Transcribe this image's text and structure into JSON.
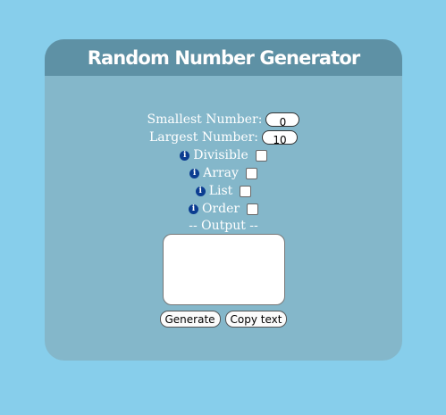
{
  "title": "Random Number Generator",
  "smallest": {
    "label": "Smallest Number:",
    "value": "0"
  },
  "largest": {
    "label": "Largest Number:",
    "value": "10"
  },
  "options": [
    {
      "label": "Divisible",
      "icon": "info-icon",
      "checked": false
    },
    {
      "label": "Array",
      "icon": "info-icon",
      "checked": false
    },
    {
      "label": "List",
      "icon": "info-icon",
      "checked": false
    },
    {
      "label": "Order",
      "icon": "info-icon",
      "checked": false
    }
  ],
  "output_label": "-- Output --",
  "output_value": "",
  "buttons": {
    "generate": "Generate",
    "copy": "Copy text"
  },
  "colors": {
    "background": "#87ceeb",
    "card": "#84b7ca",
    "header": "#5e91a5",
    "info": "#0b3d91"
  }
}
